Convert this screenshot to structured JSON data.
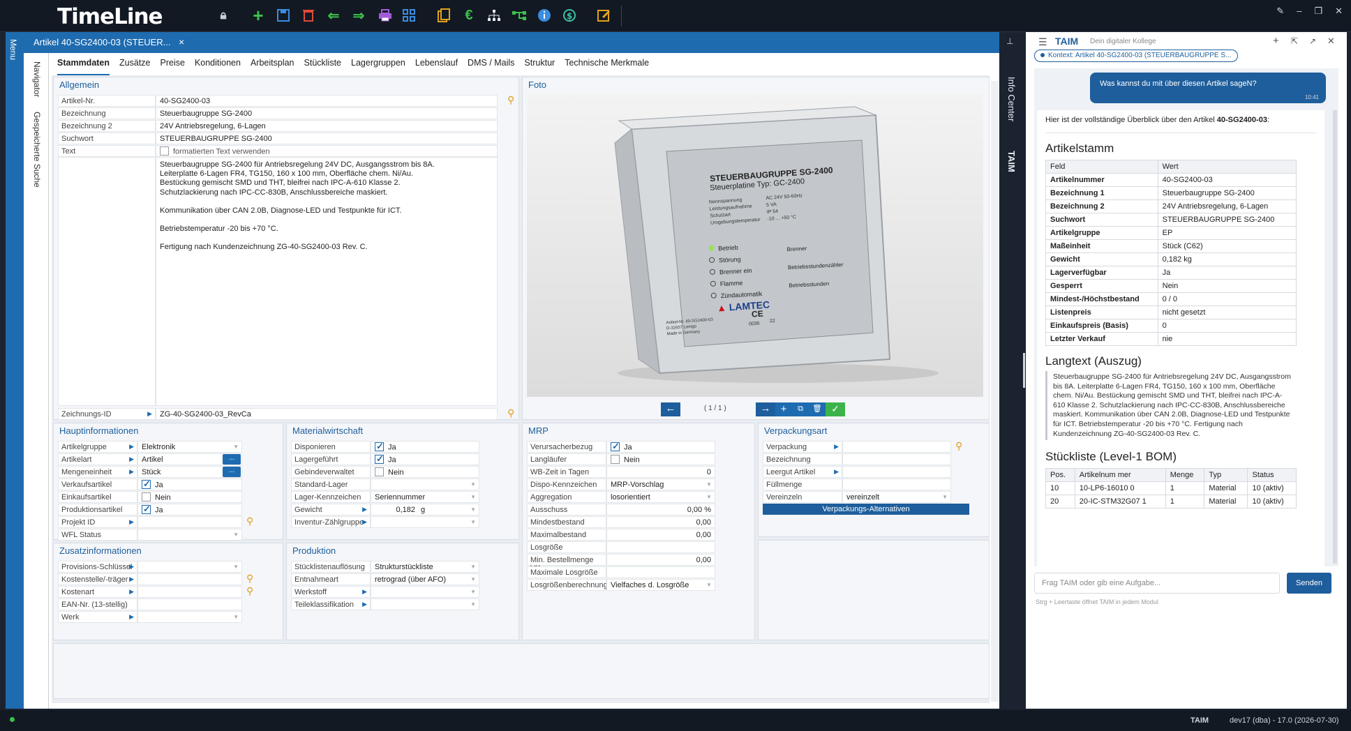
{
  "app": {
    "title": "TimeLine"
  },
  "tab": {
    "title": "Artikel 40-SG2400-03 (STEUER...",
    "close": "×"
  },
  "left_strip": {
    "menu": "Menu",
    "navigator": "Navigator",
    "saved_search": "Gespeicherte Suche"
  },
  "toolbar_icons": [
    "lock-icon",
    "add-icon",
    "save-icon",
    "delete-icon",
    "back-icon",
    "forward-icon",
    "print-icon",
    "tree-icon",
    "copy-icon",
    "euro-icon",
    "hierarchy-icon",
    "workflow-icon",
    "info-icon",
    "sync-icon",
    "edit-icon"
  ],
  "subtabs": [
    "Stammdaten",
    "Zusätze",
    "Preise",
    "Konditionen",
    "Arbeitsplan",
    "Stückliste",
    "Lagergruppen",
    "Lebenslauf",
    "DMS / Mails",
    "Struktur",
    "Technische Merkmale"
  ],
  "allgemein": {
    "title": "Allgemein",
    "artikel_nr_label": "Artikel-Nr.",
    "artikel_nr": "40-SG2400-03",
    "bez_label": "Bezeichnung",
    "bez": "Steuerbaugruppe SG-2400",
    "bez2_label": "Bezeichnung 2",
    "bez2": "24V Antriebsregelung, 6-Lagen",
    "such_label": "Suchwort",
    "such": "STEUERBAUGRUPPE SG-2400",
    "text_label": "Text",
    "text_check": "formatierten Text verwenden",
    "text_lines": [
      "Steuerbaugruppe SG-2400 für Antriebsregelung 24V DC, Ausgangsstrom bis 8A.",
      "Leiterplatte 6-Lagen FR4, TG150, 160 x 100 mm, Oberfläche chem. Ni/Au.",
      "Bestückung gemischt SMD und THT, bleifrei nach IPC-A-610 Klasse 2.",
      "Schutzlackierung nach IPC-CC-830B, Anschlussbereiche maskiert.",
      "",
      "Kommunikation über CAN 2.0B, Diagnose-LED und Testpunkte für ICT.",
      "",
      "Betriebstemperatur -20 bis +70 °C.",
      "",
      "Fertigung nach Kundenzeichnung ZG-40-SG2400-03 Rev. C."
    ],
    "zeich_label": "Zeichnungs-ID",
    "zeich": "ZG-40-SG2400-03_RevCa"
  },
  "foto": {
    "title": "Foto",
    "pager": "( 1 / 1 )",
    "device": {
      "heading": "STEUERBAUGRUPPE SG-2400",
      "sub": "Steuerplatine Typ: GC-2400",
      "spec_labels": [
        "Nennspannung",
        "Leistungsaufnahme",
        "Schutzart",
        "Umgebungstemperatur"
      ],
      "spec_values": [
        "AC 24V 50-60Hz",
        "5 VA",
        "IP 54",
        "-10 ... +50 °C"
      ],
      "leds": [
        "Betrieb",
        "Störung",
        "Brenner ein",
        "Flamme",
        "Zündautomatik"
      ],
      "right_labels": [
        "Brenner",
        "Betriebsstundenzähler",
        "Betriebsstunden"
      ],
      "brand": "LAMTEC",
      "footer": [
        "Artikel-Nr. 40-SG2400-03",
        "D-32657 Lemgo",
        "Made in Germany"
      ],
      "ce": "CE",
      "code1": "0036",
      "code2": "22"
    }
  },
  "haupt": {
    "title": "Hauptinformationen",
    "rows": [
      {
        "label": "Artikelgruppe",
        "value": "Elektronik",
        "arrow": true,
        "dd": true
      },
      {
        "label": "Artikelart",
        "value": "Artikel",
        "arrow": true,
        "dd": true,
        "btn": "..."
      },
      {
        "label": "Mengeneinheit",
        "value": "Stück",
        "arrow": true,
        "dd": true,
        "btn": "..."
      },
      {
        "label": "Verkaufsartikel",
        "value": "Ja",
        "check": true
      },
      {
        "label": "Einkaufsartikel",
        "value": "Nein",
        "check": false
      },
      {
        "label": "Produktionsartikel",
        "value": "Ja",
        "check": true
      },
      {
        "label": "Projekt ID",
        "value": "",
        "arrow": true,
        "mag": true
      },
      {
        "label": "WFL Status",
        "value": "",
        "dd": true
      }
    ]
  },
  "material": {
    "title": "Materialwirtschaft",
    "rows": [
      {
        "label": "Disponieren",
        "value": "Ja",
        "check": true
      },
      {
        "label": "Lagergeführt",
        "value": "Ja",
        "check": true
      },
      {
        "label": "Gebindeverwaltet",
        "value": "Nein",
        "check": false
      },
      {
        "label": "Standard-Lager",
        "value": "",
        "dd": true
      },
      {
        "label": "Lager-Kennzeichen",
        "value": "Seriennummer",
        "dd": true
      },
      {
        "label": "Gewicht",
        "value": "0,182",
        "unit": "g",
        "arrow": true,
        "dd": true
      },
      {
        "label": "Inventur-Zählgruppe",
        "value": "",
        "arrow": true,
        "dd": true
      }
    ]
  },
  "mrp": {
    "title": "MRP",
    "rows": [
      {
        "label": "Verursacherbezug",
        "value": "Ja",
        "check": true
      },
      {
        "label": "Langläufer",
        "value": "Nein",
        "check": false
      },
      {
        "label": "WB-Zeit in Tagen",
        "num": "0"
      },
      {
        "label": "Dispo-Kennzeichen",
        "value": "MRP-Vorschlag",
        "dd": true
      },
      {
        "label": "Aggregation",
        "value": "losorientiert",
        "dd": true
      },
      {
        "label": "Ausschuss",
        "num": "0,00 %"
      },
      {
        "label": "Mindestbestand",
        "num": "0,00"
      },
      {
        "label": "Maximalbestand",
        "num": "0,00"
      },
      {
        "label": "Losgröße",
        "num": ""
      },
      {
        "label": "Min. Bestellmenge VK",
        "num": "0,00"
      },
      {
        "label": "Maximale Losgröße",
        "num": ""
      },
      {
        "label": "Losgrößenberechnung",
        "value": "Vielfaches d. Losgröße",
        "dd": true
      }
    ]
  },
  "verpack": {
    "title": "Verpackungsart",
    "rows": [
      {
        "label": "Verpackung",
        "value": "",
        "arrow": true,
        "mag": true
      },
      {
        "label": "Bezeichnung",
        "value": ""
      },
      {
        "label": "Leergut Artikel",
        "value": "",
        "arrow": true
      },
      {
        "label": "Füllmenge",
        "value": ""
      },
      {
        "label": "Vereinzeln",
        "value": "vereinzelt",
        "dd": true
      }
    ],
    "button": "Verpackungs-Alternativen"
  },
  "zusatz": {
    "title": "Zusatzinformationen",
    "rows": [
      {
        "label": "Provisions-Schlüssel",
        "value": "",
        "arrow": true,
        "dd": true
      },
      {
        "label": "Kostenstelle/-träger",
        "value": "",
        "arrow": true,
        "mag": true
      },
      {
        "label": "Kostenart",
        "value": "",
        "arrow": true,
        "mag": true
      },
      {
        "label": "EAN-Nr. (13-stellig)",
        "value": ""
      },
      {
        "label": "Werk",
        "value": "",
        "arrow": true,
        "dd": true
      }
    ]
  },
  "produktion": {
    "title": "Produktion",
    "rows": [
      {
        "label": "Stücklistenauflösung",
        "value": "Strukturstückliste",
        "dd": true
      },
      {
        "label": "Entnahmeart",
        "value": "retrograd (über AFO)",
        "dd": true
      },
      {
        "label": "Werkstoff",
        "value": "",
        "arrow": true,
        "dd": true
      },
      {
        "label": "Teileklassifikation",
        "value": "",
        "arrow": true,
        "dd": true
      }
    ]
  },
  "right_tabs": {
    "info": "Info Center",
    "taim": "TAIM"
  },
  "taim": {
    "name": "TAIM",
    "subtitle": "Dein digitaler Kollege",
    "context": "Kontext: Artikel 40-SG2400-03 (STEUERBAUGRUPPE S...",
    "user_msg": "Was kannst du mit über diesen Artikel sageN?",
    "user_time": "10:41",
    "intro_prefix": "Hier ist der vollständige Überblick über den Artikel ",
    "intro_bold": "40-SG2400-03",
    "intro_suffix": ":",
    "h_stamm": "Artikelstamm",
    "stamm_head": [
      "Feld",
      "Wert"
    ],
    "stamm_rows": [
      [
        "Artikelnummer",
        "40-SG2400-03"
      ],
      [
        "Bezeichnung 1",
        "Steuerbaugruppe SG-2400"
      ],
      [
        "Bezeichnung 2",
        "24V Antriebsregelung, 6-Lagen"
      ],
      [
        "Suchwort",
        "STEUERBAUGRUPPE SG-2400"
      ],
      [
        "Artikelgruppe",
        "EP"
      ],
      [
        "Maßeinheit",
        "Stück (C62)"
      ],
      [
        "Gewicht",
        "0,182 kg"
      ],
      [
        "Lagerverfügbar",
        "Ja"
      ],
      [
        "Gesperrt",
        "Nein"
      ],
      [
        "Mindest-/Höchstbestand",
        "0 / 0"
      ],
      [
        "Listenpreis",
        "nicht gesetzt"
      ],
      [
        "Einkaufspreis (Basis)",
        "0"
      ],
      [
        "Letzter Verkauf",
        "nie"
      ]
    ],
    "h_lang": "Langtext (Auszug)",
    "langtext": "Steuerbaugruppe SG-2400 für Antriebsregelung 24V DC, Ausgangsstrom bis 8A. Leiterplatte 6-Lagen FR4, TG150, 160 x 100 mm, Oberfläche chem. Ni/Au. Bestückung gemischt SMD und THT, bleifrei nach IPC-A-610 Klasse 2. Schutzlackierung nach IPC-CC-830B, Anschlussbereiche maskiert. Kommunikation über CAN 2.0B, Diagnose-LED und Testpunkte für ICT. Betriebstemperatur -20 bis +70 °C. Fertigung nach Kundenzeichnung ZG-40-SG2400-03 Rev. C.",
    "h_bom": "Stückliste (Level-1 BOM)",
    "bom_head": [
      "Pos.",
      "Artikelnum mer",
      "Menge",
      "Typ",
      "Status"
    ],
    "bom_rows": [
      [
        "10",
        "10-LP6-16010 0",
        "1",
        "Material",
        "10 (aktiv)"
      ],
      [
        "20",
        "20-IC-STM32G07 1",
        "1",
        "Material",
        "10 (aktiv)"
      ]
    ],
    "input_placeholder": "Frag TAIM oder gib eine Aufgabe...",
    "send": "Senden",
    "hint": "Strg + Leertaste öffnet TAIM in jedem Modul"
  },
  "status": {
    "taim": "TAIM",
    "env": "dev17 (dba) - 17.0 (2026-07-30)"
  }
}
